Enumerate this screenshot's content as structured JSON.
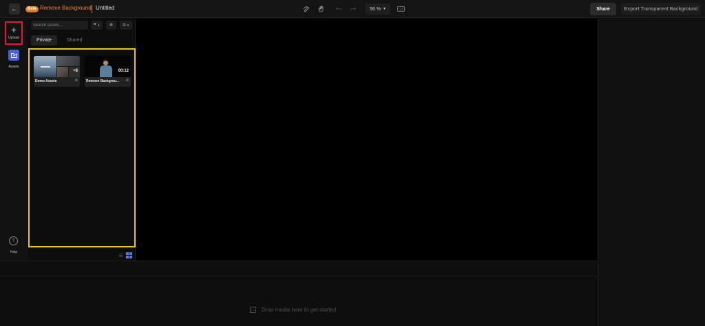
{
  "header": {
    "back_icon": "arrow-left-icon",
    "beta_badge": "Beta",
    "app_title": "Remove Background",
    "doc_title": "Untitled",
    "tools": [
      "pen-icon",
      "hand-icon",
      "undo-icon",
      "redo-icon"
    ],
    "zoom_label": "56 %",
    "keyboard_icon": "keyboard-icon",
    "share_label": "Share",
    "export_label": "Export Transparent Background"
  },
  "rail": {
    "upload_label": "Upload",
    "assets_label": "Assets",
    "help_label": "Help"
  },
  "assets_panel": {
    "search_placeholder": "Search assets...",
    "tabs": [
      {
        "label": "Private",
        "active": true
      },
      {
        "label": "Shared",
        "active": false
      }
    ],
    "cards": [
      {
        "label": "Demo Assets",
        "badge": "+6"
      },
      {
        "label": "Remove Backgrou...",
        "badge": "00:12"
      }
    ]
  },
  "timeline": {
    "drop_hint": "Drop media here to get started"
  },
  "colors": {
    "accent_orange": "#e8843a",
    "assets_blue": "#4b5fd6",
    "highlight_yellow": "#f0c21a",
    "highlight_red": "#e01e35"
  }
}
